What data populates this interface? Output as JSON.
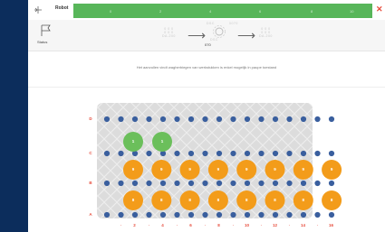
{
  "topbar": {
    "robot_label": "Robot",
    "ticks": [
      "0",
      "2",
      "4",
      "6",
      "8",
      "10"
    ],
    "close_icon": "close-icon"
  },
  "toolbar": {
    "status_label": "Status",
    "left_readout": {
      "line1": "0 0 0",
      "line2": "0 0 0",
      "line3": "DA-200"
    },
    "middle_readout": {
      "line1": "0 0 0",
      "line2": "DSC"
    },
    "right_readout": {
      "line1": "0 0 0",
      "line2": "0 0 0",
      "line3": "DA-200"
    },
    "top_small_left": "DSC",
    "top_small_right": "0070",
    "gear_value": "070"
  },
  "instruction": "Het aanvullen vindt wagherbiegen van werkstukken is enkel mogelijk in paupe toestand",
  "plate": {
    "row_labels": [
      "D",
      "C",
      "B",
      "A"
    ],
    "column_numbers": [
      "2",
      "4",
      "6",
      "8",
      "10",
      "12",
      "14",
      "16"
    ],
    "column_separators": [
      "-",
      "-",
      "-",
      "-",
      "-",
      "-",
      "-",
      "-"
    ],
    "green_pieces": [
      "1",
      "1"
    ],
    "orange_row_b": [
      "9",
      "9",
      "9",
      "9",
      "9",
      "9",
      "9",
      "9"
    ],
    "orange_row_a": [
      "8",
      "8",
      "8",
      "8",
      "8",
      "8",
      "8",
      "8"
    ],
    "colors": {
      "green": "#6bbf5b",
      "orange": "#f39c1a",
      "dot": "#3a5f9e",
      "label": "#e74c3c",
      "plate": "#dcdcdc"
    }
  }
}
